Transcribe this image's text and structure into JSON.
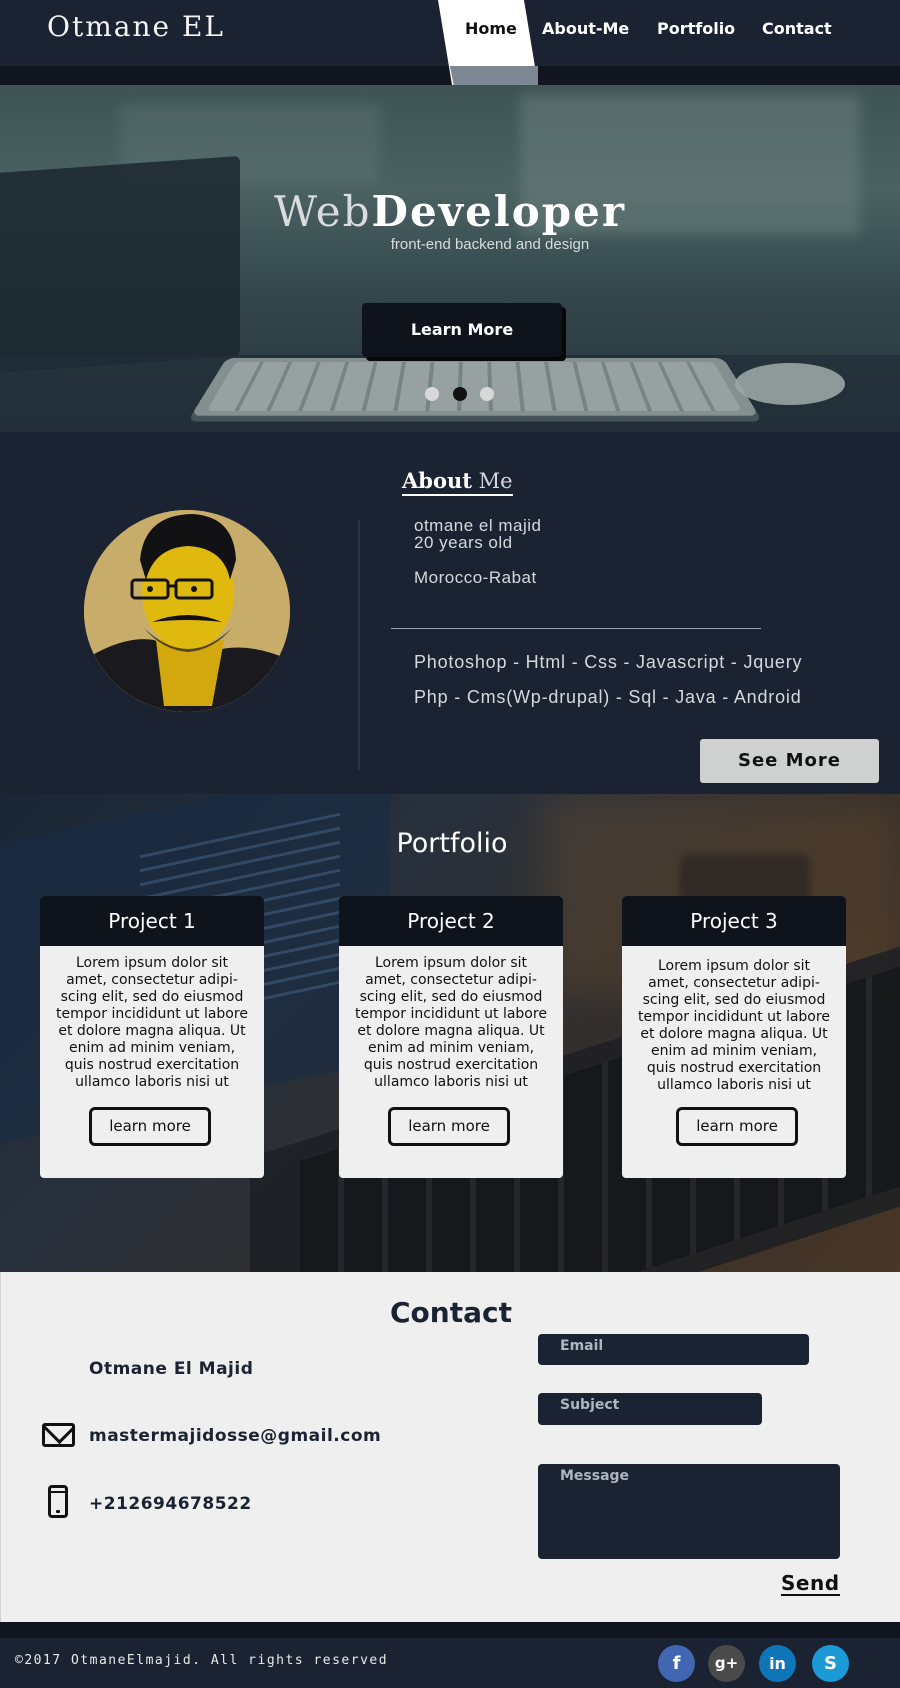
{
  "header": {
    "logo": "Otmane EL",
    "nav": [
      "Home",
      "About-Me",
      "Portfolio",
      "Contact"
    ],
    "active_nav": "Home"
  },
  "hero": {
    "title_light": "Web",
    "title_bold": "Developer",
    "subtitle": "front-end backend and design",
    "button": "Learn More",
    "carousel_active_index": 1,
    "carousel_count": 3
  },
  "about": {
    "title_bold": "About",
    "title_light": " Me",
    "name": "otmane el majid",
    "age": "20 years old",
    "location": "Morocco-Rabat",
    "skills_line1": "Photoshop - Html - Css - Javascript - Jquery",
    "skills_line2": "Php - Cms(Wp-drupal) - Sql - Java - Android",
    "see_more": "See More"
  },
  "portfolio": {
    "title": "Portfolio",
    "projects": [
      {
        "title": "Project 1",
        "text": "Lorem ipsum dolor sit amet, consectetur adipi-scing elit, sed do eiusmod tempor incididunt ut labore et dolore magna aliqua. Ut enim ad minim veniam, quis nostrud exercitation ullamco laboris nisi ut",
        "button": "learn more"
      },
      {
        "title": "Project 2",
        "text": "Lorem ipsum dolor sit amet, consectetur adipi-scing elit, sed do eiusmod tempor incididunt ut labore et dolore magna aliqua. Ut enim ad minim veniam, quis nostrud exercitation ullamco laboris nisi ut",
        "button": "learn more"
      },
      {
        "title": "Project 3",
        "text": "Lorem ipsum dolor sit amet, consectetur adipi-scing elit, sed do eiusmod tempor incididunt ut labore et dolore magna aliqua. Ut enim ad minim veniam, quis nostrud exercitation ullamco laboris nisi ut",
        "button": "learn more"
      }
    ]
  },
  "contact": {
    "title": "Contact",
    "name": "Otmane El Majid",
    "email": "mastermajidosse@gmail.com",
    "phone": "+212694678522",
    "email_placeholder": "Email",
    "subject_placeholder": "Subject",
    "message_placeholder": "Message",
    "send": "Send"
  },
  "footer": {
    "copyright": "©2017 OtmaneElmajid. All rights reserved",
    "social": [
      {
        "name": "facebook-icon",
        "glyph": "f",
        "color": "#4267b2"
      },
      {
        "name": "google-plus-icon",
        "glyph": "g+",
        "color": "#4a4a4a"
      },
      {
        "name": "linkedin-icon",
        "glyph": "in",
        "color": "#0e76b8"
      },
      {
        "name": "skype-icon",
        "glyph": "S",
        "color": "#1c9ad6"
      }
    ]
  },
  "colors": {
    "dark": "#1b2231",
    "darker": "#0f131c",
    "light": "#efefef"
  }
}
